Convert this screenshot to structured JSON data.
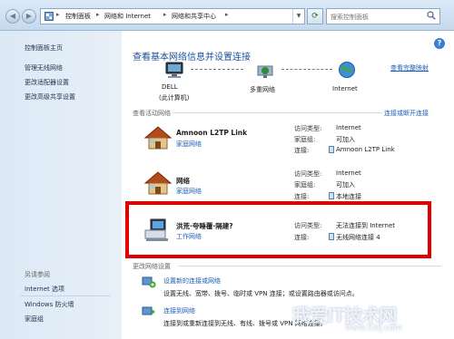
{
  "address_bar": {
    "breadcrumbs": [
      "控制面板",
      "网络和 Internet",
      "网络和共享中心"
    ],
    "search_placeholder": "搜索控制面板"
  },
  "sidebar": {
    "items": [
      {
        "label": "控制面板主页"
      },
      {
        "label": "管理无线网络"
      },
      {
        "label": "更改适配器设置"
      },
      {
        "label": "更改高级共享设置"
      }
    ],
    "see_also_heading": "另请参阅",
    "see_also": [
      {
        "label": "Internet 选项"
      },
      {
        "label": "Windows 防火墙"
      },
      {
        "label": "家庭组"
      }
    ]
  },
  "main": {
    "title": "查看基本网络信息并设置连接",
    "view_full_map": "查看完整映射",
    "map": {
      "computer_name": "DELL",
      "computer_sub": "(此计算机)",
      "middle": "多重网络",
      "end": "Internet"
    },
    "active_networks_heading": "查看活动网络",
    "connect_disconnect": "连接或断开连接",
    "networks": [
      {
        "name": "Amnoon L2TP Link",
        "type": "家庭网络",
        "rows": [
          {
            "key": "访问类型:",
            "value": "Internet"
          },
          {
            "key": "家庭组:",
            "value": "可加入"
          },
          {
            "key": "连接:",
            "value": "Amnoon L2TP Link"
          }
        ]
      },
      {
        "name": "网络",
        "type": "家庭网络",
        "rows": [
          {
            "key": "访问类型:",
            "value": "Internet"
          },
          {
            "key": "家庭组:",
            "value": "可加入"
          },
          {
            "key": "连接:",
            "value": "本地连接"
          }
        ]
      },
      {
        "name": "洪荒·夸睡覆·隔建?",
        "type": "工作网络",
        "rows": [
          {
            "key": "访问类型:",
            "value": "无法连接到 Internet"
          },
          {
            "key": "连接:",
            "value": "无线网络连接 4"
          }
        ]
      }
    ],
    "change_settings_heading": "更改网络设置",
    "tasks": [
      {
        "link": "设置新的连接或网络",
        "desc": "设置无线、宽带、拨号、临时或 VPN 连接；或设置路由器或访问点。"
      },
      {
        "link": "连接到网络",
        "desc": "连接到或重新连接到无线、有线、拨号或 VPN 网络连接。"
      }
    ]
  },
  "watermark": {
    "text": "我爱IT技术网",
    "url": "www.52ij.com"
  },
  "colors": {
    "link": "#1c5fb5",
    "title": "#1e4f98",
    "highlight": "#e10000",
    "sidebar_bg": "#dce9f6"
  }
}
